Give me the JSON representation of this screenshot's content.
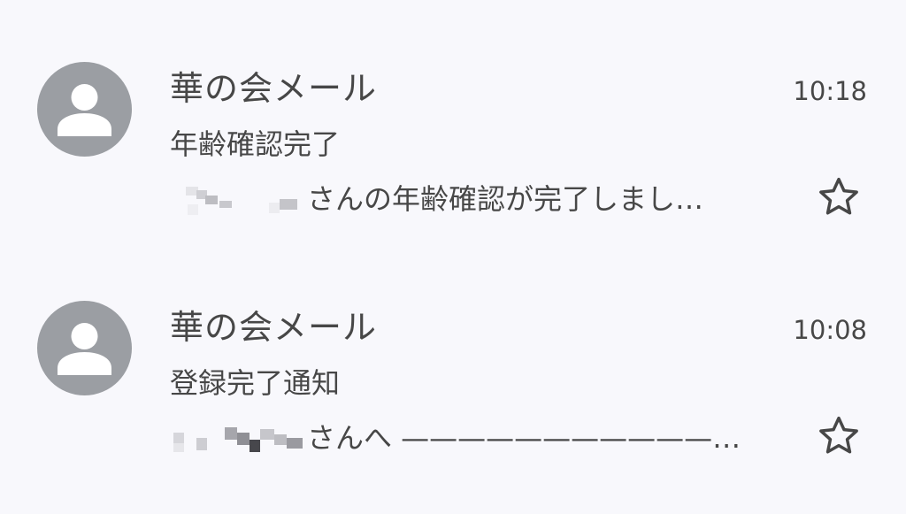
{
  "emails": [
    {
      "sender": "華の会メール",
      "time": "10:18",
      "subject": "年齢確認完了",
      "snippet": "さんの年齢確認が完了しまし…",
      "starred": false,
      "icon_avatar": "person-avatar-icon",
      "icon_star": "star-outline-icon"
    },
    {
      "sender": "華の会メール",
      "time": "10:08",
      "subject": "登録完了通知",
      "snippet": "さんへ ———————————…",
      "starred": false,
      "icon_avatar": "person-avatar-icon",
      "icon_star": "star-outline-icon"
    }
  ],
  "colors": {
    "background": "#f8f8fc",
    "text": "#474747",
    "avatar": "#9b9ea3"
  }
}
